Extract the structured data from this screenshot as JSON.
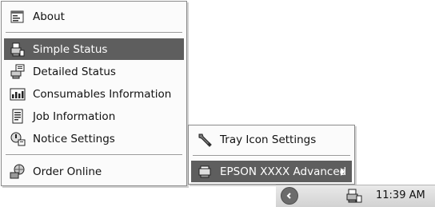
{
  "main_menu": {
    "items": [
      {
        "label": "About",
        "icon": "about-icon",
        "highlighted": false
      },
      {
        "label": "Simple Status",
        "icon": "printer-status-icon",
        "highlighted": true
      },
      {
        "label": "Detailed Status",
        "icon": "detailed-status-icon",
        "highlighted": false
      },
      {
        "label": "Consumables Information",
        "icon": "ink-icon",
        "highlighted": false
      },
      {
        "label": "Job Information",
        "icon": "job-document-icon",
        "highlighted": false
      },
      {
        "label": "Notice Settings",
        "icon": "notice-settings-icon",
        "highlighted": false
      },
      {
        "label": "Order Online",
        "icon": "order-online-icon",
        "highlighted": false
      }
    ]
  },
  "sub_menu": {
    "items": [
      {
        "label": "Tray Icon Settings",
        "icon": "wrench-icon",
        "highlighted": false
      },
      {
        "label": "EPSON XXXX Advanced",
        "icon": "printer-icon",
        "highlighted": true
      }
    ]
  },
  "taskbar": {
    "clock": "11:39 AM",
    "chevron_icon": "chevron-left-icon",
    "tray_icon": "printer-tray-icon"
  },
  "colors": {
    "highlight": "#5e5e5e",
    "menu_bg": "#fbfbfb"
  }
}
